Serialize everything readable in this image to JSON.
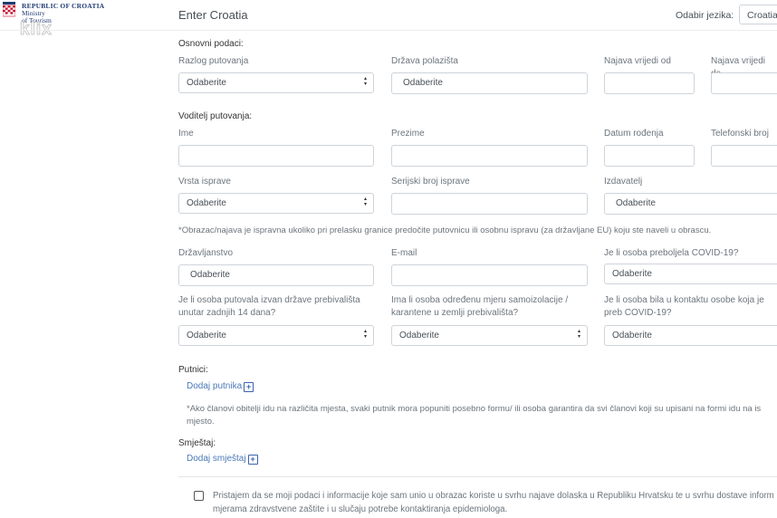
{
  "logo": {
    "line1": "REPUBLIC OF CROATIA",
    "line2": "Ministry",
    "line3": "of Tourism",
    "watermark": "klix"
  },
  "header": {
    "title": "Enter Croatia",
    "language_label": "Odabir jezika:",
    "language_value": "Croatian"
  },
  "basic": {
    "section_title": "Osnovni podaci:",
    "reason_label": "Razlog putovanja",
    "reason_value": "Odaberite",
    "departure_country_label": "Država polazišta",
    "departure_country_value": "Odaberite",
    "valid_from_label": "Najava vrijedi od",
    "valid_to_label": "Najava vrijedi do"
  },
  "leader": {
    "section_title": "Voditelj putovanja:",
    "first_name_label": "Ime",
    "last_name_label": "Prezime",
    "birth_date_label": "Datum rođenja",
    "phone_label": "Telefonski broj",
    "doc_type_label": "Vrsta isprave",
    "doc_type_value": "Odaberite",
    "doc_serial_label": "Serijski broj isprave",
    "issuer_label": "Izdavatelj",
    "issuer_value": "Odaberite",
    "document_note": "*Obrazac/najava je ispravna ukoliko pri prelasku granice predočite putovnicu ili osobnu ispravu (za državljane EU) koju ste naveli u obrascu.",
    "citizenship_label": "Državljanstvo",
    "citizenship_value": "Odaberite",
    "email_label": "E-mail",
    "covid_recovered_label": "Je li osoba preboljela COVID-19?",
    "covid_recovered_value": "Odaberite",
    "travelled_label": "Je li osoba putovala izvan države prebivališta unutar zadnjih 14 dana?",
    "travelled_value": "Odaberite",
    "isolation_label": "Ima li osoba određenu mjeru samoizolacije / karantene u zemlji prebivališta?",
    "isolation_value": "Odaberite",
    "contact_label": "Je li osoba bila u kontaktu osobe koja je preb COVID-19?",
    "contact_value": "Odaberite"
  },
  "passengers": {
    "section_title": "Putnici:",
    "add_link": "Dodaj putnika",
    "note": "*Ako članovi obitelji idu na različita mjesta, svaki putnik mora popuniti posebno formu/ ili osoba garantira da svi članovi koji su upisani na formi idu na is mjesto."
  },
  "accommodation": {
    "section_title": "Smještaj:",
    "add_link": "Dodaj smještaj"
  },
  "consent": {
    "text": "Pristajem da se moji podaci i informacije koje sam unio u obrazac koriste u svrhu najave dolaska u Republiku Hrvatsku te u svrhu dostave inform mjerama zdravstvene zaštite i u slučaju potrebe kontaktiranja epidemiologa."
  }
}
